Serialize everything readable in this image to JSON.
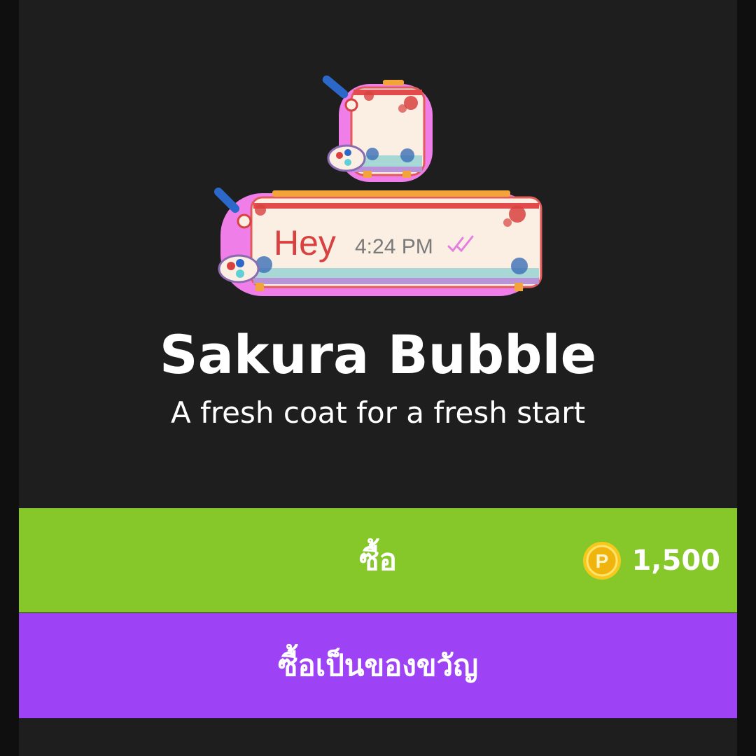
{
  "sticker": {
    "name": "Sakura Bubble",
    "description": "A fresh coat for a fresh start",
    "preview_message": "Hey",
    "preview_time": "4:24 PM"
  },
  "buy": {
    "label": "ซื้อ",
    "price": "1,500",
    "currency_icon": "p-coin-icon",
    "color": "#86c72a"
  },
  "gift": {
    "label": "ซื้อเป็นของขวัญ",
    "color": "#9d43f5"
  },
  "colors": {
    "background": "#1e1e1e",
    "outer_background": "#0f0f0f",
    "bubble_pink": "#f07ee8",
    "bubble_cream": "#fbeee3",
    "accent_red": "#d8413f",
    "coin_gold": "#f6c81b"
  }
}
